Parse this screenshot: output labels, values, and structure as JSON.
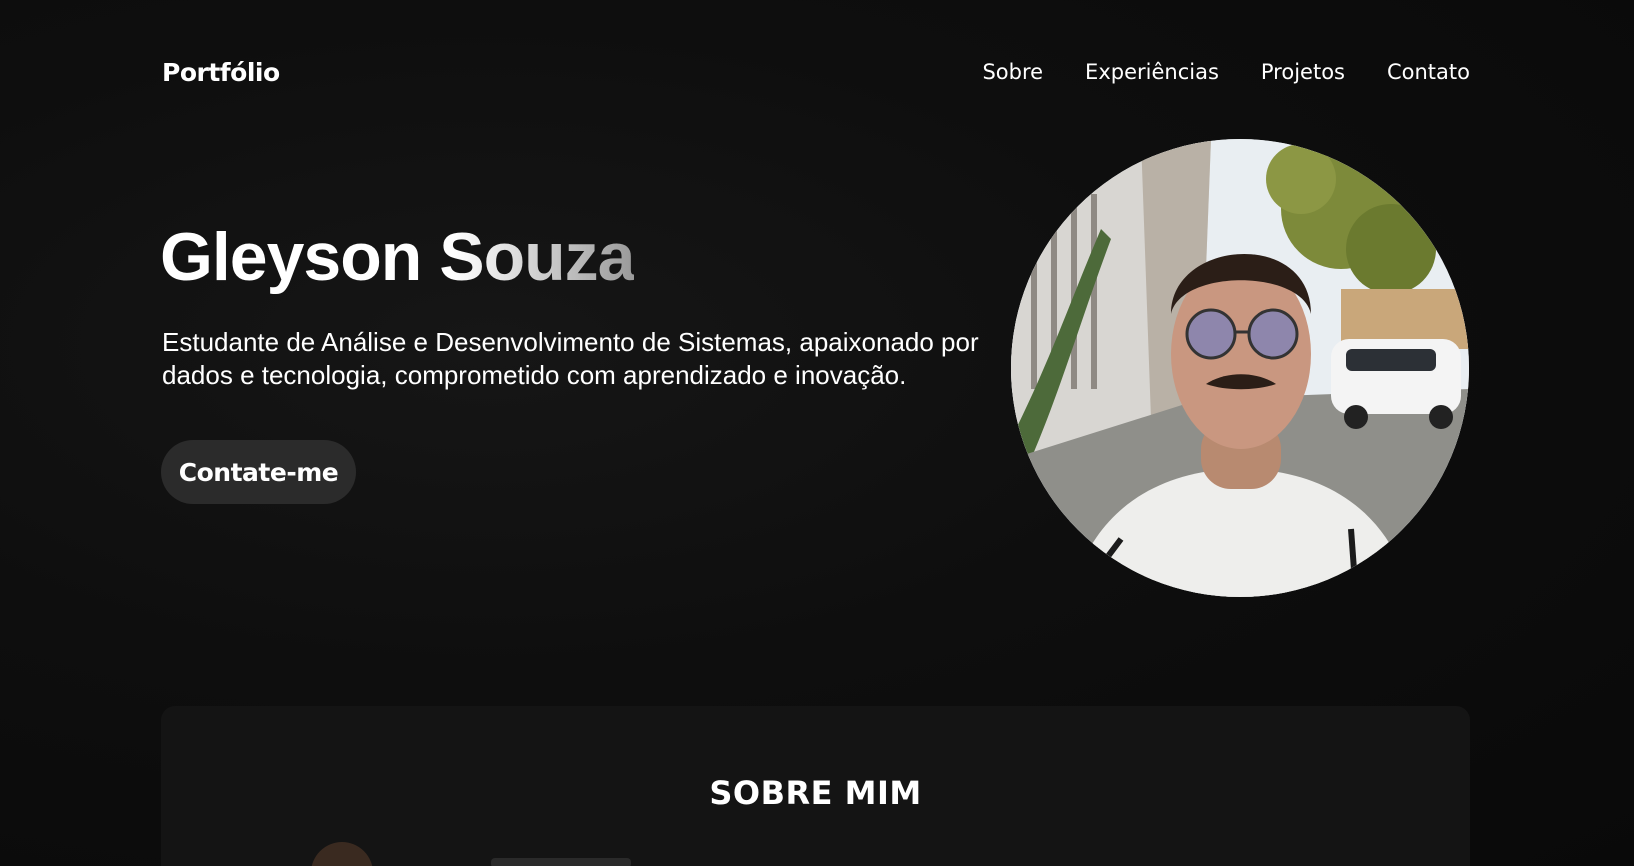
{
  "header": {
    "logo": "Portfólio",
    "nav": [
      {
        "label": "Sobre"
      },
      {
        "label": "Experiências"
      },
      {
        "label": "Projetos"
      },
      {
        "label": "Contato"
      }
    ]
  },
  "hero": {
    "name": "Gleyson Souza",
    "description": "Estudante de Análise e Desenvolvimento de Sistemas, apaixonado por dados e tecnologia, comprometido com aprendizado e inovação.",
    "cta_label": "Contate-me"
  },
  "about": {
    "title": "SOBRE MIM"
  },
  "colors": {
    "background": "#0d0d0d",
    "button": "#2b2b2b",
    "card": "#141414",
    "text": "#ffffff"
  }
}
